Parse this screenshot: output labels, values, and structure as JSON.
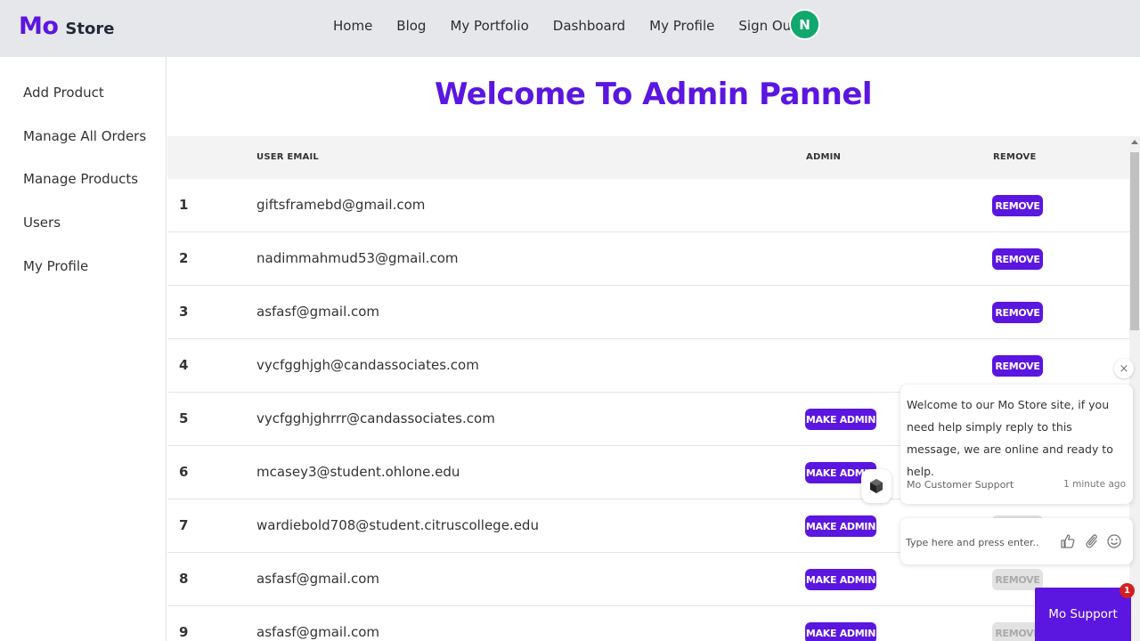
{
  "brand": {
    "mo": "Mo",
    "store": "Store"
  },
  "nav": [
    "Home",
    "Blog",
    "My Portfolio",
    "Dashboard",
    "My Profile",
    "Sign Out"
  ],
  "avatar": {
    "initial": "N",
    "color": "#10a86d"
  },
  "sidebar": [
    "Add Product",
    "Manage All Orders",
    "Manage Products",
    "Users",
    "My Profile"
  ],
  "page_title": "Welcome To Admin Pannel",
  "table": {
    "headers": {
      "email": "USER EMAIL",
      "admin": "ADMIN",
      "remove": "REMOVE"
    },
    "make_admin_label": "MAKE ADMIN",
    "remove_label": "REMOVE",
    "rows": [
      {
        "num": "1",
        "email": "giftsframebd@gmail.com",
        "show_make_admin": false,
        "remove_enabled": true
      },
      {
        "num": "2",
        "email": "nadimmahmud53@gmail.com",
        "show_make_admin": false,
        "remove_enabled": true
      },
      {
        "num": "3",
        "email": "asfasf@gmail.com",
        "show_make_admin": false,
        "remove_enabled": true
      },
      {
        "num": "4",
        "email": "vycfgghjgh@candassociates.com",
        "show_make_admin": false,
        "remove_enabled": true
      },
      {
        "num": "5",
        "email": "vycfgghjghrrr@candassociates.com",
        "show_make_admin": true,
        "remove_enabled": false
      },
      {
        "num": "6",
        "email": "mcasey3@student.ohlone.edu",
        "show_make_admin": true,
        "remove_enabled": false
      },
      {
        "num": "7",
        "email": "wardiebold708@student.citruscollege.edu",
        "show_make_admin": true,
        "remove_enabled": false
      },
      {
        "num": "8",
        "email": "asfasf@gmail.com",
        "show_make_admin": true,
        "remove_enabled": false
      },
      {
        "num": "9",
        "email": "asfasf@gmail.com",
        "show_make_admin": true,
        "remove_enabled": false
      }
    ]
  },
  "chat": {
    "close_symbol": "×",
    "message": "Welcome to our Mo Store site, if you need help simply reply to this message, we are online and ready to help.",
    "from": "Mo Customer Support",
    "time": "1 minute ago",
    "input_placeholder": "Type here and press enter..",
    "support_label": "Mo Support",
    "badge_count": "1"
  },
  "colors": {
    "accent": "#5b16e0",
    "header_bg": "#e5e7eb",
    "disabled": "#e2e2e2"
  }
}
